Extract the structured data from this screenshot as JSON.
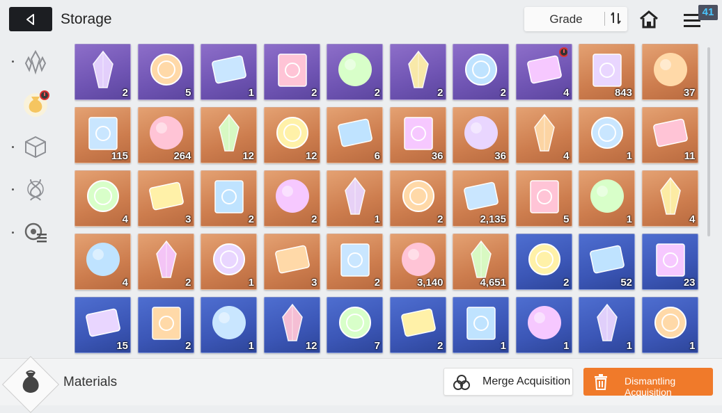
{
  "header": {
    "title": "Storage",
    "sort_label": "Grade",
    "notification_count": "41"
  },
  "sidebar": {
    "items": [
      {
        "icon": "crystal-icon",
        "active": false
      },
      {
        "icon": "pouch-icon",
        "active": true,
        "alert": true
      },
      {
        "icon": "cube-icon",
        "active": false
      },
      {
        "icon": "dna-icon",
        "active": false
      },
      {
        "icon": "gear-list-icon",
        "active": false
      }
    ]
  },
  "items": [
    {
      "count": "2",
      "bg": "purple",
      "icon": "card-pair-icon"
    },
    {
      "count": "5",
      "bg": "purple",
      "icon": "book-emblem-icon"
    },
    {
      "count": "1",
      "bg": "purple",
      "icon": "dark-rock-icon"
    },
    {
      "count": "2",
      "bg": "purple",
      "icon": "silver-orb-icon"
    },
    {
      "count": "2",
      "bg": "purple",
      "icon": "beast-head-icon"
    },
    {
      "count": "2",
      "bg": "purple",
      "icon": "pink-rock-icon"
    },
    {
      "count": "2",
      "bg": "purple",
      "icon": "red-geode-icon"
    },
    {
      "count": "4",
      "bg": "purple",
      "icon": "warning-pyramid-icon",
      "alert": true
    },
    {
      "count": "843",
      "bg": "orange",
      "icon": "blue-tentacle-icon"
    },
    {
      "count": "37",
      "bg": "orange",
      "icon": "chip-box-icon"
    },
    {
      "count": "115",
      "bg": "orange",
      "icon": "gold-ticket-icon"
    },
    {
      "count": "264",
      "bg": "orange",
      "icon": "gold-coupon-icon"
    },
    {
      "count": "12",
      "bg": "orange",
      "icon": "purple-eye-icon"
    },
    {
      "count": "12",
      "bg": "orange",
      "icon": "golden-crescent-icon"
    },
    {
      "count": "6",
      "bg": "orange",
      "icon": "red-crystal-icon"
    },
    {
      "count": "36",
      "bg": "orange",
      "icon": "orange-crystal-icon"
    },
    {
      "count": "36",
      "bg": "orange",
      "icon": "purple-crystal-icon"
    },
    {
      "count": "4",
      "bg": "orange",
      "icon": "green-crystal-icon"
    },
    {
      "count": "1",
      "bg": "orange",
      "icon": "sword-manual-icon"
    },
    {
      "count": "11",
      "bg": "orange",
      "icon": "eye-manual-icon"
    },
    {
      "count": "4",
      "bg": "orange",
      "icon": "rainbow-manual-icon"
    },
    {
      "count": "3",
      "bg": "orange",
      "icon": "arrow-manual-icon"
    },
    {
      "count": "2",
      "bg": "orange",
      "icon": "gold-medal-sword-icon"
    },
    {
      "count": "2",
      "bg": "orange",
      "icon": "gold-medal-shield-icon"
    },
    {
      "count": "1",
      "bg": "orange",
      "icon": "gold-medal-box-icon"
    },
    {
      "count": "2",
      "bg": "orange",
      "icon": "gold-medal-arrow-icon"
    },
    {
      "count": "2,135",
      "bg": "orange",
      "icon": "yellow-shards-icon"
    },
    {
      "count": "5",
      "bg": "orange",
      "icon": "blue-cube-icon"
    },
    {
      "count": "1",
      "bg": "orange",
      "icon": "sneakers-icon"
    },
    {
      "count": "4",
      "bg": "orange",
      "icon": "star-book-icon"
    },
    {
      "count": "4",
      "bg": "orange",
      "icon": "spray-gun-icon"
    },
    {
      "count": "2",
      "bg": "orange",
      "icon": "dreamcatcher-icon"
    },
    {
      "count": "1",
      "bg": "orange",
      "icon": "leather-journal-icon"
    },
    {
      "count": "3",
      "bg": "orange",
      "icon": "guitar-pick-icon"
    },
    {
      "count": "2",
      "bg": "orange",
      "icon": "ancient-page-icon"
    },
    {
      "count": "3,140",
      "bg": "orange",
      "icon": "music-ribbon-icon"
    },
    {
      "count": "4,651",
      "bg": "orange",
      "icon": "black-urchin-icon"
    },
    {
      "count": "2",
      "bg": "blue",
      "icon": "id-card-icon"
    },
    {
      "count": "52",
      "bg": "blue",
      "icon": "fire-feather-icon"
    },
    {
      "count": "23",
      "bg": "blue",
      "icon": "green-shard-icon"
    },
    {
      "count": "15",
      "bg": "blue",
      "icon": "blue-sword-manual-icon"
    },
    {
      "count": "2",
      "bg": "blue",
      "icon": "blue-shield-manual-icon"
    },
    {
      "count": "1",
      "bg": "blue",
      "icon": "blue-eye-manual-icon"
    },
    {
      "count": "12",
      "bg": "blue",
      "icon": "blue-rainbow-manual-icon"
    },
    {
      "count": "7",
      "bg": "blue",
      "icon": "blue-arrow-manual-icon"
    },
    {
      "count": "2",
      "bg": "blue",
      "icon": "blue-globe-manual-icon"
    },
    {
      "count": "1",
      "bg": "blue",
      "icon": "silver-medal-sword-icon"
    },
    {
      "count": "1",
      "bg": "blue",
      "icon": "silver-medal-shield-icon"
    },
    {
      "count": "1",
      "bg": "blue",
      "icon": "silver-medal-box-icon"
    },
    {
      "count": "1",
      "bg": "blue",
      "icon": "silver-medal-arrow-icon"
    }
  ],
  "footer": {
    "category_label": "Materials",
    "merge_label": "Merge Acquisition",
    "dismantle_label": "Dismantling Acquisition"
  },
  "colors": {
    "accent": "#f07a2a",
    "badge_text": "#49c6ff",
    "tile_purple": "#6f54b3",
    "tile_orange": "#cd7d4e",
    "tile_blue": "#3b56b6"
  }
}
